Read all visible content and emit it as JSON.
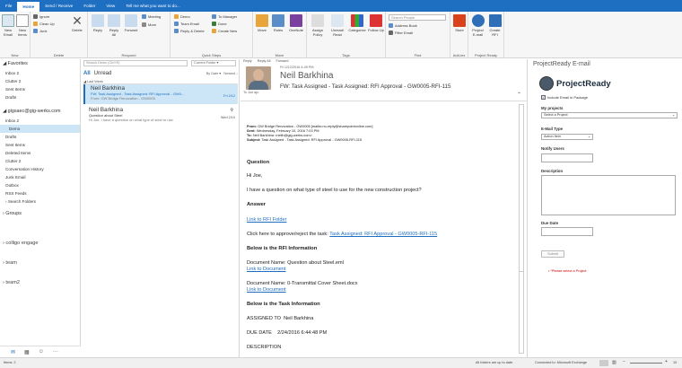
{
  "tabs": [
    "File",
    "Home",
    "Send / Receive",
    "Folder",
    "View",
    "Tell me what you want to do..."
  ],
  "ribbon": {
    "new_email": "New Email",
    "new_items": "New Items",
    "ignore": "Ignore",
    "clean_up": "Clean Up",
    "junk": "Junk",
    "delete": "Delete",
    "reply": "Reply",
    "reply_all": "Reply All",
    "forward": "Forward",
    "meeting": "Meeting",
    "more": "More",
    "demo": "Demo",
    "team_email": "Team Email",
    "reply_delete": "Reply & Delete",
    "to_manager": "To Manager",
    "done": "Done",
    "create_new": "Create New",
    "move": "Move",
    "rules": "Rules",
    "onenote": "OneNote",
    "assign_policy": "Assign Policy",
    "unread_read": "Unread/ Read",
    "categorize": "Categorize",
    "follow_up": "Follow Up",
    "search_people": "Search People",
    "address_book": "Address Book",
    "filter_email": "Filter Email",
    "store": "Store",
    "project_email": "Project E-mail",
    "create_rfi": "Create RFI",
    "groups": [
      "New",
      "Delete",
      "Respond",
      "Quick Steps",
      "Move",
      "Tags",
      "Find",
      "Add-ins",
      "Project Ready"
    ]
  },
  "folders": {
    "favorites": "Favorites",
    "fav_items": [
      "Inbox 2",
      "Clutter 2",
      "Sent Items",
      "Drafts"
    ],
    "account": "gigsaec@gig-werks.com",
    "inbox": "Inbox 2",
    "items": [
      "Demo",
      "Drafts",
      "Sent Items",
      "Deleted Items",
      "Clutter 2",
      "Conversation History",
      "Junk Email",
      "Outbox",
      "RSS Feeds",
      "Search Folders"
    ],
    "groups": "Groups",
    "others": [
      "colligo engage",
      "team",
      "team2"
    ]
  },
  "list": {
    "search": "Search Demo (Ctrl+E)",
    "scope": "Current Folder",
    "tab_all": "All",
    "tab_unread": "Unread",
    "sort": "By Date",
    "order": "Newest",
    "group": "Last Week",
    "messages": [
      {
        "from": "Neil Barkhina",
        "subject": "FW: Task Assigned - Task Assigned: RFI Approval - GW0...",
        "date": "Fri 2/12",
        "preview": "From: GW Bridge Renovation - GW0005"
      },
      {
        "from": "Neil Barkhina",
        "subject": "Question about Steel",
        "date": "Wed 2/10",
        "preview": "Hi Joe, I have a question on what type of steel to use"
      }
    ]
  },
  "reading": {
    "actions": [
      "Reply",
      "Reply All",
      "Forward"
    ],
    "date": "Fri 2/12/2016 4:49 PM",
    "sender": "Neil Barkhina",
    "subject": "FW: Task Assigned - Task Assigned: RFI Approval - GW0005-RFI-115",
    "to": "To   Joe ajo",
    "meta_from_label": "From:",
    "meta_from": "GW Bridge Renovation - GW0005 [mailto:no-reply@sharepointonline.com]",
    "meta_sent_label": "Sent:",
    "meta_sent": "Wednesday, February 10, 2016 7:03 PM",
    "meta_to_label": "To:",
    "meta_to": "Neil Barkhina <neilb@gig-werks.com>",
    "meta_subj_label": "Subject:",
    "meta_subj": "Task Assigned - Task Assigned: RFI Approval - GW0005-RFI-115",
    "question_h": "Question",
    "hi": "Hi Joe,",
    "question": "I have a question on what type of steel to use for the new construction  project?",
    "answer_h": "Answer",
    "rfi_link": "Link to RFI Folder",
    "approve_text": "Click here to approve/reject the task: ",
    "approve_link": "Task Assigned: RFI Approval - GW0005-RFI-115",
    "below_rfi": "Below is the RFI Information",
    "doc1": "Document Name: Question about Steel.eml",
    "doc_link": "Link to Document",
    "doc2": "Document Name: 0-Transmittal Cover Sheet.docx",
    "below_task": "Below is the Task Information",
    "assigned_label": "ASSIGNED TO",
    "assigned": "Neil Barkhina",
    "due_label": "DUE DATE",
    "due": "2/24/2016 6:44:48 PM",
    "desc": "DESCRIPTION"
  },
  "projectready": {
    "title": "ProjectReady E-mail",
    "logo": "ProjectReady",
    "include": "Include Email in Package",
    "my_projects": "My projects",
    "select_project": "Select a Project",
    "type_label": "E-Mail Type",
    "type_value": "Action Item",
    "notify": "Notify Users",
    "description": "Description",
    "due_date": "Due Date",
    "submit": "Submit",
    "error": "*Please select a Project"
  },
  "status": {
    "items": "Items: 2",
    "sync": "All folders are up to date.",
    "conn": "Connected to: Microsoft Exchange",
    "zoom": "10"
  }
}
